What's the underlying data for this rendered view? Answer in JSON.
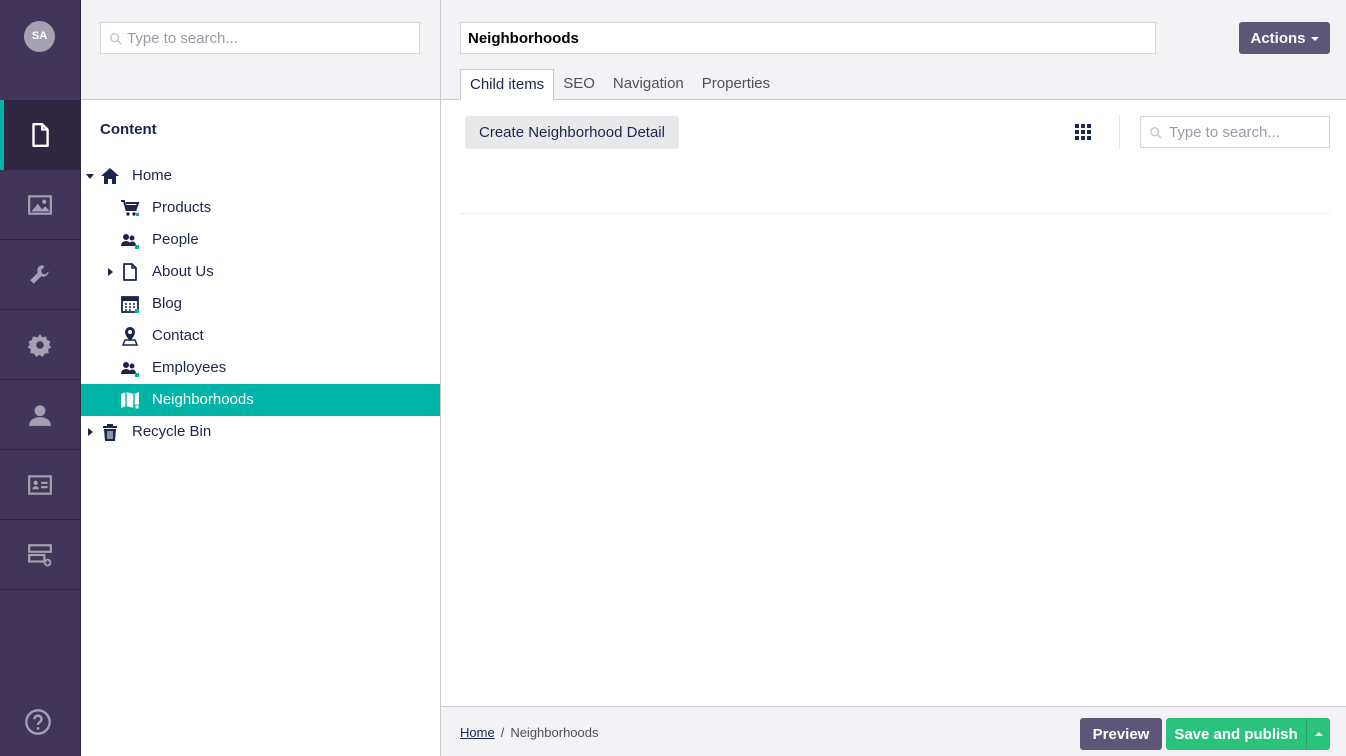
{
  "user": {
    "initials": "SA"
  },
  "sections": [
    {
      "name": "content",
      "icon": "document-icon",
      "active": true
    },
    {
      "name": "media",
      "icon": "image-icon",
      "active": false
    },
    {
      "name": "settings",
      "icon": "wrench-icon",
      "active": false
    },
    {
      "name": "packages",
      "icon": "gear-icon",
      "active": false
    },
    {
      "name": "users",
      "icon": "user-icon",
      "active": false
    },
    {
      "name": "members",
      "icon": "id-card-icon",
      "active": false
    },
    {
      "name": "forms",
      "icon": "form-icon",
      "active": false
    }
  ],
  "help": {
    "icon": "help-icon"
  },
  "tree": {
    "search_placeholder": "Type to search...",
    "title": "Content",
    "nodes": [
      {
        "label": "Home",
        "icon": "home-icon",
        "level": 0,
        "expanded": true
      },
      {
        "label": "Products",
        "icon": "cart-icon",
        "level": 1
      },
      {
        "label": "People",
        "icon": "users-icon",
        "level": 1
      },
      {
        "label": "About Us",
        "icon": "document-icon",
        "level": 1,
        "has_children": true
      },
      {
        "label": "Blog",
        "icon": "calendar-icon",
        "level": 1
      },
      {
        "label": "Contact",
        "icon": "map-pin-icon",
        "level": 1
      },
      {
        "label": "Employees",
        "icon": "users-icon",
        "level": 1
      },
      {
        "label": "Neighborhoods",
        "icon": "map-icon",
        "level": 1,
        "selected": true
      },
      {
        "label": "Recycle Bin",
        "icon": "trash-icon",
        "level": 0,
        "has_children": true
      }
    ]
  },
  "editor": {
    "name": "Neighborhoods",
    "actions_label": "Actions",
    "tabs": [
      {
        "label": "Child items",
        "active": true
      },
      {
        "label": "SEO",
        "active": false
      },
      {
        "label": "Navigation",
        "active": false
      },
      {
        "label": "Properties",
        "active": false
      }
    ],
    "create_label": "Create Neighborhood Detail",
    "list_search_placeholder": "Type to search..."
  },
  "footer": {
    "breadcrumb": [
      "Home",
      "Neighborhoods"
    ],
    "breadcrumb_separator": "/",
    "preview_label": "Preview",
    "publish_label": "Save and publish"
  },
  "colors": {
    "rail": "#413659",
    "accent": "#00b5a8",
    "button": "#5e5678",
    "publish": "#2bc37c"
  }
}
